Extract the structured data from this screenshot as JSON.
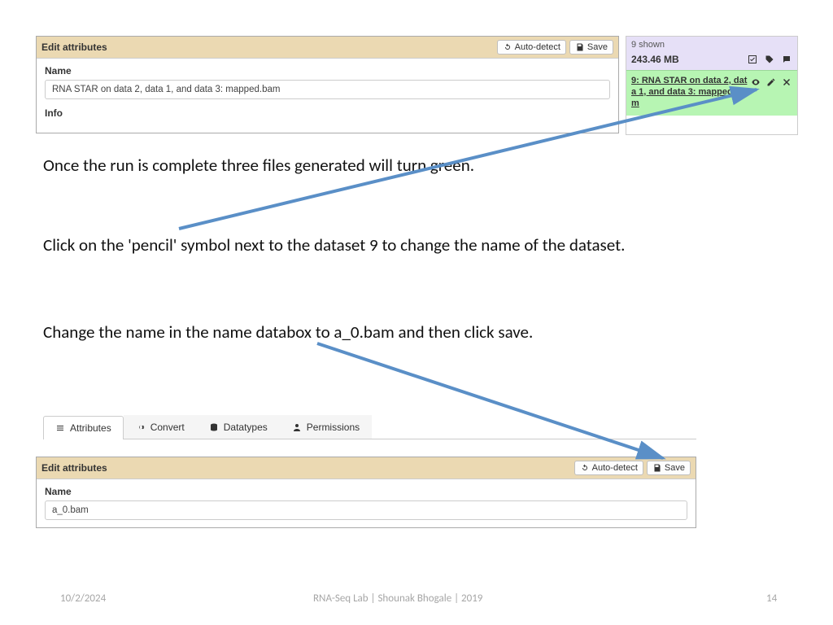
{
  "colors": {
    "arrow": "#5a8fc7",
    "header_bg": "#ebd9b2",
    "history_top_bg": "#e6e0f7",
    "history_item_bg": "#b7f5b3"
  },
  "panel1": {
    "title": "Edit attributes",
    "auto_detect": "Auto-detect",
    "save": "Save",
    "name_label": "Name",
    "name_value": "RNA STAR on data 2, data 1, and data 3: mapped.bam",
    "info_label": "Info"
  },
  "history": {
    "shown": "9 shown",
    "size": "243.46 MB",
    "item_label": "9: RNA STAR on data 2, data 1, and data 3: mapped.bam"
  },
  "instructions": {
    "line1": "Once the run is complete three files generated will turn green.",
    "line2": "Click on the 'pencil' symbol next to the dataset 9 to change the name of the dataset.",
    "line3": "Change the name in the name databox to a_0.bam and then click save."
  },
  "tabs": {
    "attributes": "Attributes",
    "convert": "Convert",
    "datatypes": "Datatypes",
    "permissions": "Permissions"
  },
  "panel2": {
    "title": "Edit attributes",
    "auto_detect": "Auto-detect",
    "save": "Save",
    "name_label": "Name",
    "name_value": "a_0.bam"
  },
  "footer": {
    "date": "10/2/2024",
    "title": "RNA-Seq Lab  | Shounak Bhogale | 2019",
    "page": "14"
  }
}
